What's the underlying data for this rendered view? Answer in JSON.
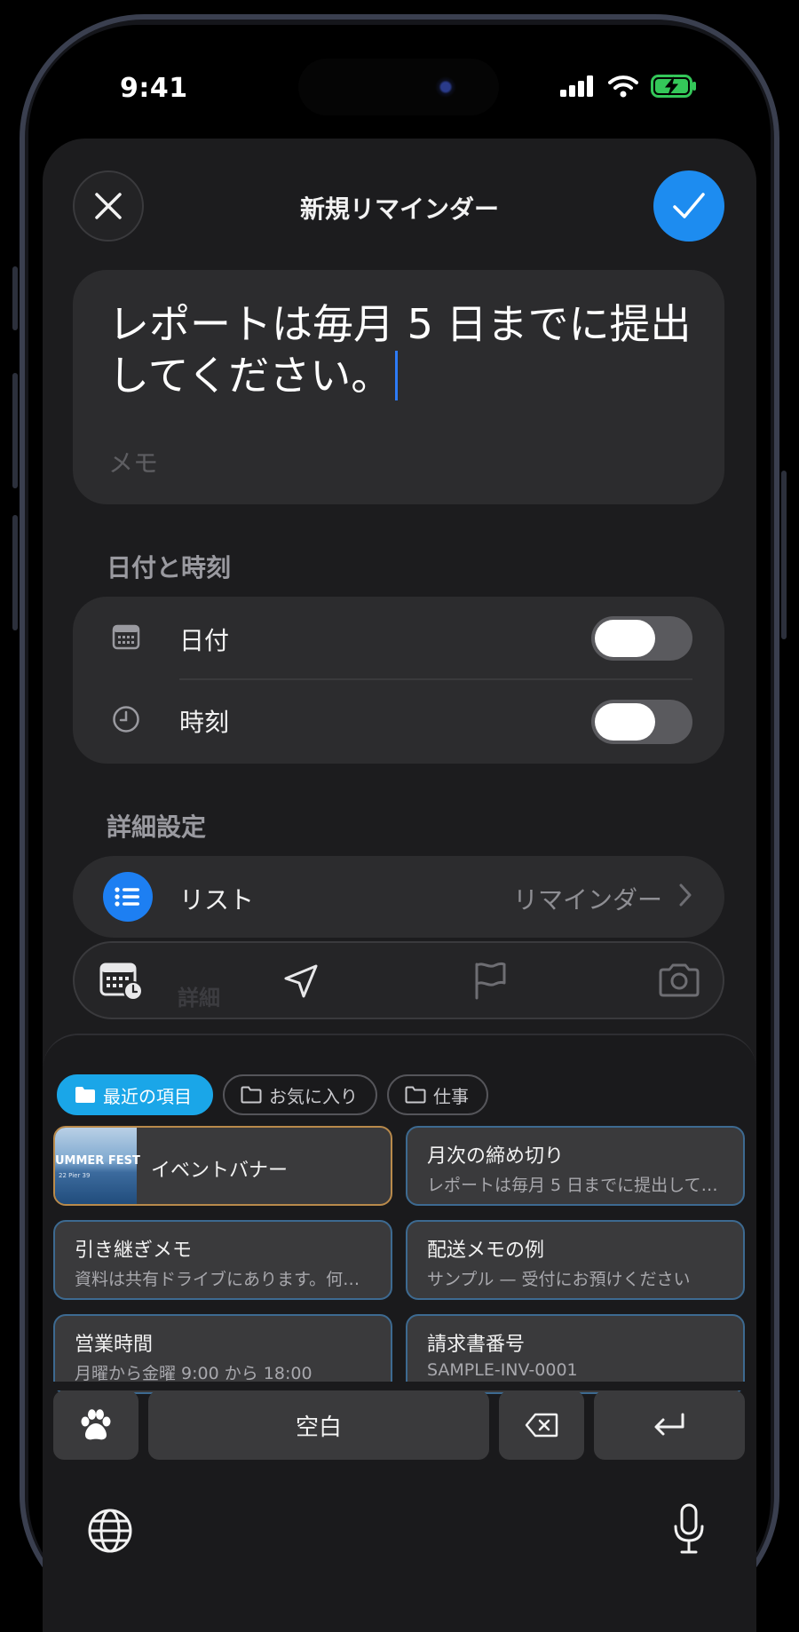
{
  "status": {
    "time": "9:41"
  },
  "header": {
    "title": "新規リマインダー"
  },
  "reminder": {
    "text": "レポートは毎月 5 日までに提出してください。",
    "memo_placeholder": "メモ"
  },
  "sections": {
    "date_time": "日付と時刻",
    "details": "詳細設定"
  },
  "date_time_rows": [
    {
      "label": "日付",
      "enabled": false
    },
    {
      "label": "時刻",
      "enabled": false
    }
  ],
  "list_row": {
    "label": "リスト",
    "value": "リマインダー"
  },
  "toolbar_ghost": "詳細",
  "clipboard": {
    "chips": [
      {
        "label": "最近の項目",
        "active": true
      },
      {
        "label": "お気に入り",
        "active": false
      },
      {
        "label": "仕事",
        "active": false
      }
    ],
    "image_item": {
      "title": "イベントバナー",
      "thumb_text": "UMMER FEST",
      "thumb_sub": "22   Pier 39"
    },
    "items": [
      {
        "title": "月次の締め切り",
        "subtitle": "レポートは毎月 5 日までに提出して…"
      },
      {
        "title": "引き継ぎメモ",
        "subtitle": "資料は共有ドライブにあります。何か…"
      },
      {
        "title": "配送メモの例",
        "subtitle": "サンプル — 受付にお預けください"
      },
      {
        "title": "営業時間",
        "subtitle": "月曜から金曜 9:00 から 18:00"
      },
      {
        "title": "請求書番号",
        "subtitle": "SAMPLE-INV-0001"
      }
    ]
  },
  "keyboard": {
    "space_label": "空白"
  },
  "colors": {
    "accent": "#1d8cf0",
    "chip_active": "#1aa6e8",
    "sheet": "#1c1c1e",
    "card": "#2c2c2e"
  }
}
